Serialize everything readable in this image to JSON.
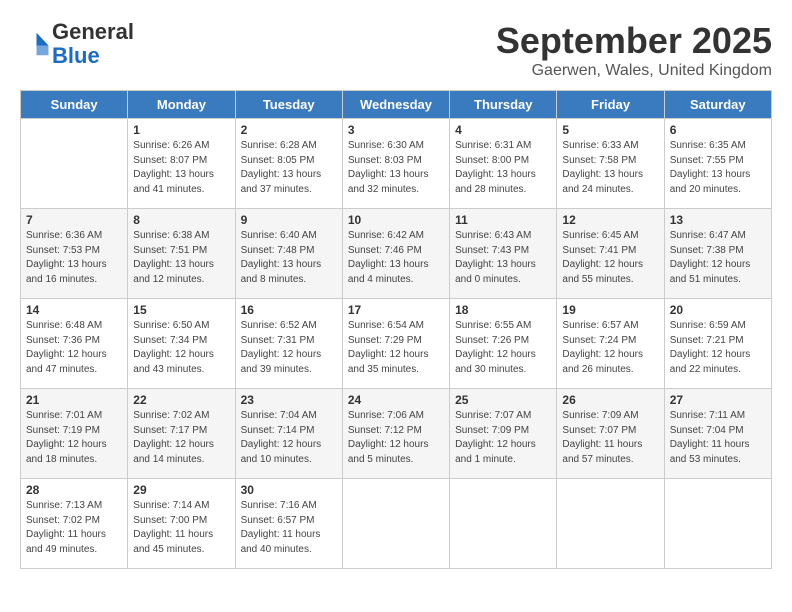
{
  "header": {
    "logo_line1": "General",
    "logo_line2": "Blue",
    "title": "September 2025",
    "subtitle": "Gaerwen, Wales, United Kingdom"
  },
  "days_of_week": [
    "Sunday",
    "Monday",
    "Tuesday",
    "Wednesday",
    "Thursday",
    "Friday",
    "Saturday"
  ],
  "weeks": [
    [
      {
        "day": "",
        "info": ""
      },
      {
        "day": "1",
        "info": "Sunrise: 6:26 AM\nSunset: 8:07 PM\nDaylight: 13 hours\nand 41 minutes."
      },
      {
        "day": "2",
        "info": "Sunrise: 6:28 AM\nSunset: 8:05 PM\nDaylight: 13 hours\nand 37 minutes."
      },
      {
        "day": "3",
        "info": "Sunrise: 6:30 AM\nSunset: 8:03 PM\nDaylight: 13 hours\nand 32 minutes."
      },
      {
        "day": "4",
        "info": "Sunrise: 6:31 AM\nSunset: 8:00 PM\nDaylight: 13 hours\nand 28 minutes."
      },
      {
        "day": "5",
        "info": "Sunrise: 6:33 AM\nSunset: 7:58 PM\nDaylight: 13 hours\nand 24 minutes."
      },
      {
        "day": "6",
        "info": "Sunrise: 6:35 AM\nSunset: 7:55 PM\nDaylight: 13 hours\nand 20 minutes."
      }
    ],
    [
      {
        "day": "7",
        "info": "Sunrise: 6:36 AM\nSunset: 7:53 PM\nDaylight: 13 hours\nand 16 minutes."
      },
      {
        "day": "8",
        "info": "Sunrise: 6:38 AM\nSunset: 7:51 PM\nDaylight: 13 hours\nand 12 minutes."
      },
      {
        "day": "9",
        "info": "Sunrise: 6:40 AM\nSunset: 7:48 PM\nDaylight: 13 hours\nand 8 minutes."
      },
      {
        "day": "10",
        "info": "Sunrise: 6:42 AM\nSunset: 7:46 PM\nDaylight: 13 hours\nand 4 minutes."
      },
      {
        "day": "11",
        "info": "Sunrise: 6:43 AM\nSunset: 7:43 PM\nDaylight: 13 hours\nand 0 minutes."
      },
      {
        "day": "12",
        "info": "Sunrise: 6:45 AM\nSunset: 7:41 PM\nDaylight: 12 hours\nand 55 minutes."
      },
      {
        "day": "13",
        "info": "Sunrise: 6:47 AM\nSunset: 7:38 PM\nDaylight: 12 hours\nand 51 minutes."
      }
    ],
    [
      {
        "day": "14",
        "info": "Sunrise: 6:48 AM\nSunset: 7:36 PM\nDaylight: 12 hours\nand 47 minutes."
      },
      {
        "day": "15",
        "info": "Sunrise: 6:50 AM\nSunset: 7:34 PM\nDaylight: 12 hours\nand 43 minutes."
      },
      {
        "day": "16",
        "info": "Sunrise: 6:52 AM\nSunset: 7:31 PM\nDaylight: 12 hours\nand 39 minutes."
      },
      {
        "day": "17",
        "info": "Sunrise: 6:54 AM\nSunset: 7:29 PM\nDaylight: 12 hours\nand 35 minutes."
      },
      {
        "day": "18",
        "info": "Sunrise: 6:55 AM\nSunset: 7:26 PM\nDaylight: 12 hours\nand 30 minutes."
      },
      {
        "day": "19",
        "info": "Sunrise: 6:57 AM\nSunset: 7:24 PM\nDaylight: 12 hours\nand 26 minutes."
      },
      {
        "day": "20",
        "info": "Sunrise: 6:59 AM\nSunset: 7:21 PM\nDaylight: 12 hours\nand 22 minutes."
      }
    ],
    [
      {
        "day": "21",
        "info": "Sunrise: 7:01 AM\nSunset: 7:19 PM\nDaylight: 12 hours\nand 18 minutes."
      },
      {
        "day": "22",
        "info": "Sunrise: 7:02 AM\nSunset: 7:17 PM\nDaylight: 12 hours\nand 14 minutes."
      },
      {
        "day": "23",
        "info": "Sunrise: 7:04 AM\nSunset: 7:14 PM\nDaylight: 12 hours\nand 10 minutes."
      },
      {
        "day": "24",
        "info": "Sunrise: 7:06 AM\nSunset: 7:12 PM\nDaylight: 12 hours\nand 5 minutes."
      },
      {
        "day": "25",
        "info": "Sunrise: 7:07 AM\nSunset: 7:09 PM\nDaylight: 12 hours\nand 1 minute."
      },
      {
        "day": "26",
        "info": "Sunrise: 7:09 AM\nSunset: 7:07 PM\nDaylight: 11 hours\nand 57 minutes."
      },
      {
        "day": "27",
        "info": "Sunrise: 7:11 AM\nSunset: 7:04 PM\nDaylight: 11 hours\nand 53 minutes."
      }
    ],
    [
      {
        "day": "28",
        "info": "Sunrise: 7:13 AM\nSunset: 7:02 PM\nDaylight: 11 hours\nand 49 minutes."
      },
      {
        "day": "29",
        "info": "Sunrise: 7:14 AM\nSunset: 7:00 PM\nDaylight: 11 hours\nand 45 minutes."
      },
      {
        "day": "30",
        "info": "Sunrise: 7:16 AM\nSunset: 6:57 PM\nDaylight: 11 hours\nand 40 minutes."
      },
      {
        "day": "",
        "info": ""
      },
      {
        "day": "",
        "info": ""
      },
      {
        "day": "",
        "info": ""
      },
      {
        "day": "",
        "info": ""
      }
    ]
  ]
}
